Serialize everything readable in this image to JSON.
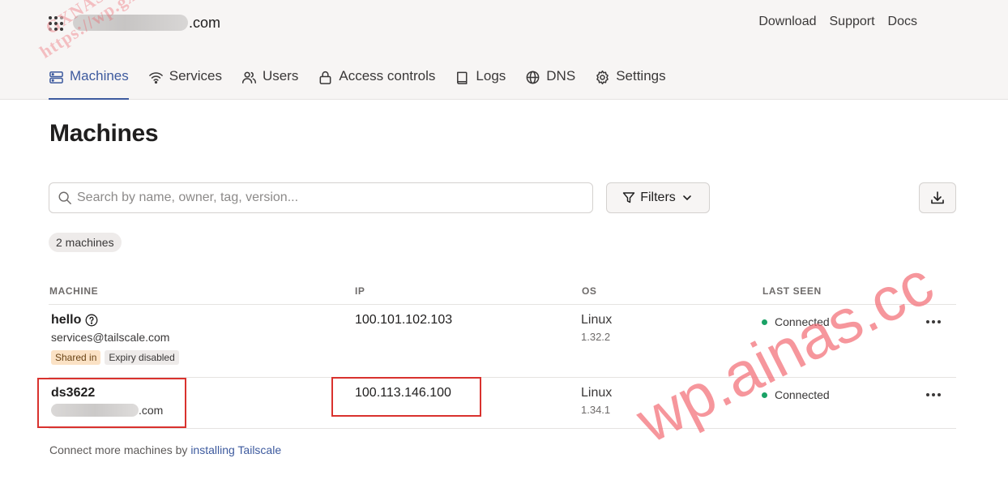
{
  "header": {
    "tenant_suffix": ".com",
    "links": [
      "Download",
      "Support",
      "Docs"
    ]
  },
  "tabs": [
    {
      "label": "Machines",
      "icon": "server-icon",
      "active": true
    },
    {
      "label": "Services",
      "icon": "wifi-icon",
      "active": false
    },
    {
      "label": "Users",
      "icon": "users-icon",
      "active": false
    },
    {
      "label": "Access controls",
      "icon": "lock-icon",
      "active": false
    },
    {
      "label": "Logs",
      "icon": "book-icon",
      "active": false
    },
    {
      "label": "DNS",
      "icon": "globe-icon",
      "active": false
    },
    {
      "label": "Settings",
      "icon": "gear-icon",
      "active": false
    }
  ],
  "page": {
    "title": "Machines",
    "search_placeholder": "Search by name, owner, tag, version...",
    "filters_label": "Filters",
    "machine_count": "2 machines"
  },
  "table": {
    "columns": [
      "MACHINE",
      "IP",
      "OS",
      "LAST SEEN"
    ],
    "rows": [
      {
        "name": "hello",
        "owner": "services@tailscale.com",
        "tags": [
          "Shared in",
          "Expiry disabled"
        ],
        "ip": "100.101.102.103",
        "os": "Linux",
        "os_version": "1.32.2",
        "last_seen": "Connected"
      },
      {
        "name": "ds3622",
        "owner_suffix": ".com",
        "ip": "100.113.146.100",
        "os": "Linux",
        "os_version": "1.34.1",
        "last_seen": "Connected"
      }
    ]
  },
  "footer": {
    "prefix": "Connect more machines by ",
    "link": "installing Tailscale"
  },
  "watermarks": {
    "top_left_line1": "GXNAS 博客",
    "top_left_line2": "https://wp.gxnas.com",
    "bottom_right": "wp.ainas.cc"
  },
  "colors": {
    "accent": "#3d5a9e",
    "status_connected": "#1aa266",
    "highlight_box": "#d9322e",
    "shared_tag_bg": "#fbe2c5"
  }
}
